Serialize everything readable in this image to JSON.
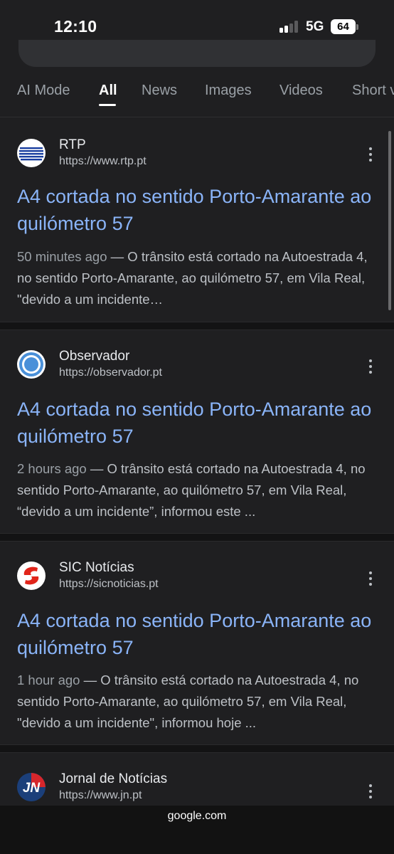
{
  "status_bar": {
    "time": "12:10",
    "network": "5G",
    "battery": "64"
  },
  "tabs": [
    {
      "label": "AI Mode",
      "active": false
    },
    {
      "label": "All",
      "active": true
    },
    {
      "label": "News",
      "active": false
    },
    {
      "label": "Images",
      "active": false
    },
    {
      "label": "Videos",
      "active": false
    },
    {
      "label": "Short videos",
      "active": false
    }
  ],
  "results": [
    {
      "site": "RTP",
      "url": "https://www.rtp.pt",
      "title": "A4 cortada no sentido Porto-Amarante ao quilómetro 57",
      "date": "50 minutes ago",
      "snippet": "O trânsito está cortado na Autoestrada 4, no sentido Porto-Amarante, ao quilómetro 57, em Vila Real, \"devido a um incidente…"
    },
    {
      "site": "Observador",
      "url": "https://observador.pt",
      "title": "A4 cortada no sentido Porto-Amarante ao quilómetro 57",
      "date": "2 hours ago",
      "snippet": "O trânsito está cortado na Autoestrada 4, no sentido Porto-Amarante, ao quilómetro 57, em Vila Real, “devido a um incidente”, informou este ..."
    },
    {
      "site": "SIC Notícias",
      "url": "https://sicnoticias.pt",
      "title": "A4 cortada no sentido Porto-Amarante ao quilómetro 57",
      "date": "1 hour ago",
      "snippet": "O trânsito está cortado na Autoestrada 4, no sentido Porto-Amarante, ao quilómetro 57, em Vila Real, \"devido a um incidente\", informou hoje ..."
    },
    {
      "site": "Jornal de Notícias",
      "url": "https://www.jn.pt",
      "logo_text": "JN"
    }
  ],
  "bottom_bar": {
    "domain": "google.com"
  },
  "colors": {
    "link": "#8ab4f8",
    "background": "#1f1f21"
  }
}
